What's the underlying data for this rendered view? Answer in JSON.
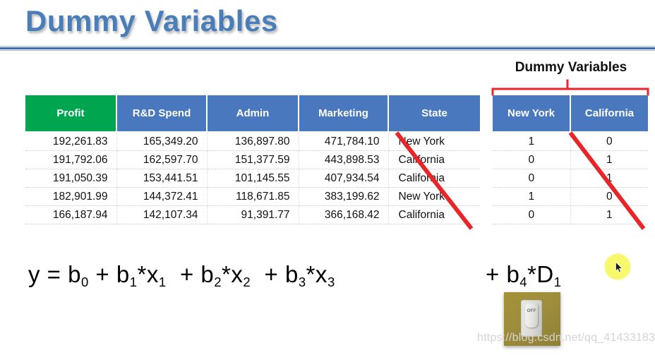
{
  "slide": {
    "title": "Dummy Variables",
    "title_color": "#4A7EBB",
    "rule_color": "#3D6FB5"
  },
  "main_table": {
    "header_colors": {
      "profit": "#00A550",
      "default": "#4978BE"
    },
    "columns": [
      "Profit",
      "R&D Spend",
      "Admin",
      "Marketing",
      "State"
    ],
    "rows": [
      [
        "192,261.83",
        "165,349.20",
        "136,897.80",
        "471,784.10",
        "New York"
      ],
      [
        "191,792.06",
        "162,597.70",
        "151,377.59",
        "443,898.53",
        "California"
      ],
      [
        "191,050.39",
        "153,441.51",
        "101,145.55",
        "407,934.54",
        "California"
      ],
      [
        "182,901.99",
        "144,372.41",
        "118,671.85",
        "383,199.62",
        "New York"
      ],
      [
        "166,187.94",
        "142,107.34",
        "91,391.77",
        "366,168.42",
        "California"
      ]
    ]
  },
  "dummy_table": {
    "caption": "Dummy Variables",
    "header_color": "#4978BE",
    "bracket_color": "#E8262A",
    "columns": [
      "New York",
      "California"
    ],
    "rows": [
      [
        "1",
        "0"
      ],
      [
        "0",
        "1"
      ],
      [
        "0",
        "1"
      ],
      [
        "1",
        "0"
      ],
      [
        "0",
        "1"
      ]
    ]
  },
  "annotations": {
    "strike_color": "#E8262A",
    "strike_state_label": "red-diagonal-strike-over-state-column",
    "strike_dummy_label": "red-diagonal-strike-over-california-column"
  },
  "formula": {
    "main": {
      "y": "y",
      "equals": "=",
      "terms": [
        {
          "coef": "b",
          "coef_sub": "0",
          "var": "",
          "var_sub": ""
        },
        {
          "coef": "b",
          "coef_sub": "1",
          "var": "x",
          "var_sub": "1"
        },
        {
          "coef": "b",
          "coef_sub": "2",
          "var": "x",
          "var_sub": "2"
        },
        {
          "coef": "b",
          "coef_sub": "3",
          "var": "x",
          "var_sub": "3"
        }
      ],
      "text": "y = b0 + b1*x1 + b2*x2 + b3*x3"
    },
    "dummy": {
      "plus": "+",
      "coef": "b",
      "coef_sub": "4",
      "star": "*",
      "var": "D",
      "var_sub": "1",
      "text": "+ b4*D1"
    }
  },
  "switch_image": {
    "label": "OFF",
    "alt": "light-switch-in-off-position"
  },
  "cursor": {
    "highlight_color": "#F7F76A"
  },
  "watermark": {
    "text": "https://blog.csdn.net/qq_41433183"
  }
}
